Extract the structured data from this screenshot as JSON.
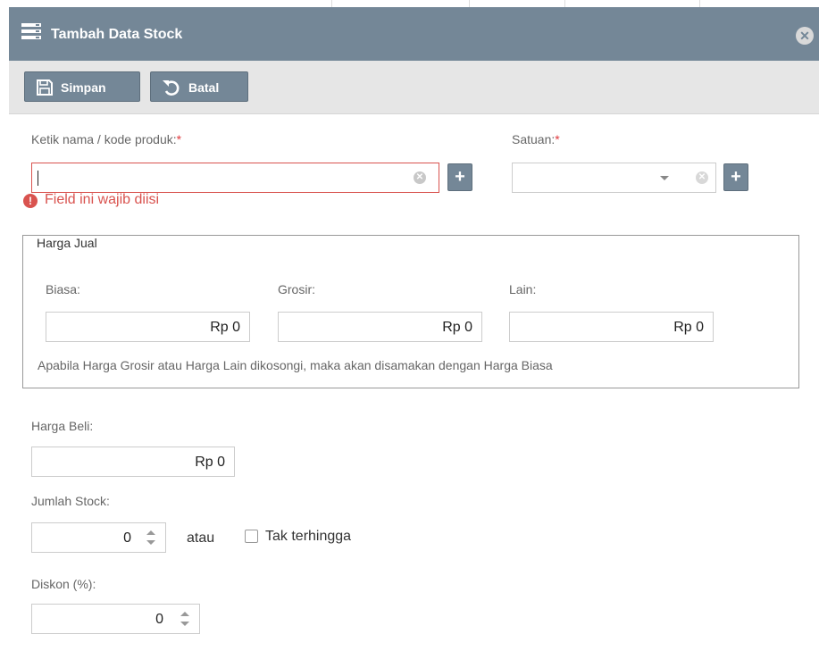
{
  "dialog": {
    "title": "Tambah Data Stock",
    "close_icon": "close-circle-icon"
  },
  "toolbar": {
    "save_label": "Simpan",
    "save_icon": "floppy-disk-icon",
    "cancel_label": "Batal",
    "cancel_icon": "undo-icon"
  },
  "product": {
    "label": "Ketik nama / kode produk:",
    "required_mark": "*",
    "value": "",
    "error": "Field ini wajib diisi",
    "add_label": "+"
  },
  "unit": {
    "label": "Satuan:",
    "required_mark": "*",
    "value": "",
    "add_label": "+"
  },
  "selling_price": {
    "legend": "Harga Jual",
    "normal_label": "Biasa:",
    "normal_value": "Rp 0",
    "wholesale_label": "Grosir:",
    "wholesale_value": "Rp 0",
    "other_label": "Lain:",
    "other_value": "Rp 0",
    "note": "Apabila Harga Grosir atau Harga Lain dikosongi, maka akan disamakan dengan Harga Biasa"
  },
  "purchase_price": {
    "label": "Harga Beli:",
    "value": "Rp 0"
  },
  "stock": {
    "label": "Jumlah Stock:",
    "value": "0",
    "or_text": "atau",
    "unlimited_label": "Tak terhingga",
    "unlimited_checked": false
  },
  "discount": {
    "label": "Diskon (%):",
    "value": "0"
  },
  "colors": {
    "header": "#748797",
    "toolbar": "#e6e6e6",
    "error": "#d9534f"
  }
}
